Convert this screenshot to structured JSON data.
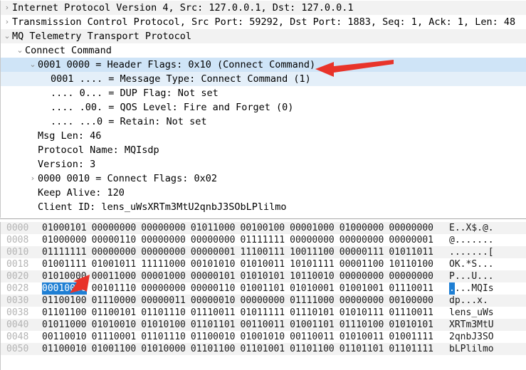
{
  "accent": {
    "selection_blue": "#1e7fd4",
    "row_highlight": "#cfe4f7",
    "row_highlight_soft": "#e4eff9",
    "stripe": "#f2f2f2",
    "annotation_red": "#e8332a"
  },
  "tree": {
    "rows": [
      {
        "indent": 0,
        "twisty": "collapsed",
        "text": "Internet Protocol Version 4, Src: 127.0.0.1, Dst: 127.0.0.1",
        "state": "stripe"
      },
      {
        "indent": 0,
        "twisty": "collapsed",
        "text": "Transmission Control Protocol, Src Port: 59292, Dst Port: 1883, Seq: 1, Ack: 1, Len: 48",
        "state": "plain"
      },
      {
        "indent": 0,
        "twisty": "expanded",
        "text": "MQ Telemetry Transport Protocol",
        "state": "stripe"
      },
      {
        "indent": 1,
        "twisty": "expanded",
        "text": "Connect Command",
        "state": "plain"
      },
      {
        "indent": 2,
        "twisty": "expanded",
        "text": "0001 0000 = Header Flags: 0x10 (Connect Command)",
        "state": "selected"
      },
      {
        "indent": 3,
        "twisty": "none",
        "text": "0001 .... = Message Type: Connect Command (1)",
        "state": "selected-soft"
      },
      {
        "indent": 3,
        "twisty": "none",
        "text": ".... 0... = DUP Flag: Not set",
        "state": "plain"
      },
      {
        "indent": 3,
        "twisty": "none",
        "text": ".... .00. = QOS Level: Fire and Forget (0)",
        "state": "plain"
      },
      {
        "indent": 3,
        "twisty": "none",
        "text": ".... ...0 = Retain: Not set",
        "state": "plain"
      },
      {
        "indent": 2,
        "twisty": "none",
        "text": "Msg Len: 46",
        "state": "plain"
      },
      {
        "indent": 2,
        "twisty": "none",
        "text": "Protocol Name: MQIsdp",
        "state": "plain"
      },
      {
        "indent": 2,
        "twisty": "none",
        "text": "Version: 3",
        "state": "plain"
      },
      {
        "indent": 2,
        "twisty": "collapsed",
        "text": "0000 0010 = Connect Flags: 0x02",
        "state": "plain"
      },
      {
        "indent": 2,
        "twisty": "none",
        "text": "Keep Alive: 120",
        "state": "plain"
      },
      {
        "indent": 2,
        "twisty": "none",
        "text": "Client ID: lens_uWsXRTm3MtU2qnbJ3SObLPlilmo",
        "state": "plain"
      }
    ]
  },
  "hexdump": {
    "format": "binary",
    "rows": [
      {
        "offset": "0000",
        "bytes": [
          "01000101",
          "00000000",
          "00000000",
          "01011000",
          "00100100",
          "00001000",
          "01000000",
          "00000000"
        ],
        "ascii": "E..X$.@.",
        "stripe": true,
        "highlight_byte": -1
      },
      {
        "offset": "0008",
        "bytes": [
          "01000000",
          "00000110",
          "00000000",
          "00000000",
          "01111111",
          "00000000",
          "00000000",
          "00000001"
        ],
        "ascii": "@.......",
        "stripe": false,
        "highlight_byte": -1
      },
      {
        "offset": "0010",
        "bytes": [
          "01111111",
          "00000000",
          "00000000",
          "00000001",
          "11100111",
          "10011100",
          "00000111",
          "01011011"
        ],
        "ascii": ".......[",
        "stripe": true,
        "highlight_byte": -1
      },
      {
        "offset": "0018",
        "bytes": [
          "01001111",
          "01001011",
          "11111000",
          "00101010",
          "01010011",
          "10101111",
          "00001100",
          "10110100"
        ],
        "ascii": "OK.*S...",
        "stripe": false,
        "highlight_byte": -1
      },
      {
        "offset": "0020",
        "bytes": [
          "01010000",
          "00011000",
          "00001000",
          "00000101",
          "01010101",
          "10110010",
          "00000000",
          "00000000"
        ],
        "ascii": "P...U...",
        "stripe": true,
        "highlight_byte": -1
      },
      {
        "offset": "0028",
        "bytes": [
          "00010000",
          "00101110",
          "00000000",
          "00000110",
          "01001101",
          "01010001",
          "01001001",
          "01110011"
        ],
        "ascii": "....MQIs",
        "stripe": false,
        "highlight_byte": 0
      },
      {
        "offset": "0030",
        "bytes": [
          "01100100",
          "01110000",
          "00000011",
          "00000010",
          "00000000",
          "01111000",
          "00000000",
          "00100000"
        ],
        "ascii": "dp...x. ",
        "stripe": true,
        "highlight_byte": -1
      },
      {
        "offset": "0038",
        "bytes": [
          "01101100",
          "01100101",
          "01101110",
          "01110011",
          "01011111",
          "01110101",
          "01010111",
          "01110011"
        ],
        "ascii": "lens_uWs",
        "stripe": false,
        "highlight_byte": -1
      },
      {
        "offset": "0040",
        "bytes": [
          "01011000",
          "01010010",
          "01010100",
          "01101101",
          "00110011",
          "01001101",
          "01110100",
          "01010101"
        ],
        "ascii": "XRTm3MtU",
        "stripe": true,
        "highlight_byte": -1
      },
      {
        "offset": "0048",
        "bytes": [
          "00110010",
          "01110001",
          "01101110",
          "01100010",
          "01001010",
          "00110011",
          "01010011",
          "01001111"
        ],
        "ascii": "2qnbJ3SO",
        "stripe": false,
        "highlight_byte": -1
      },
      {
        "offset": "0050",
        "bytes": [
          "01100010",
          "01001100",
          "01010000",
          "01101100",
          "01101001",
          "01101100",
          "01101101",
          "01101111"
        ],
        "ascii": "bLPlilmo",
        "stripe": true,
        "highlight_byte": -1
      }
    ]
  },
  "annotations": [
    {
      "name": "header-flags-arrow",
      "target": "Header Flags row",
      "color": "#e8332a",
      "direction": "left"
    },
    {
      "name": "highlighted-byte-arrow",
      "target": "byte 0x28",
      "color": "#e8332a",
      "direction": "down-left"
    }
  ]
}
